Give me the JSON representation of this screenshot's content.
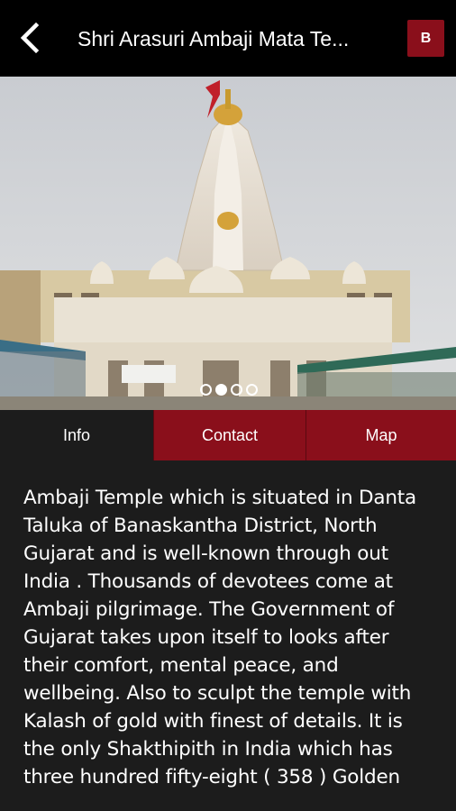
{
  "appbar": {
    "title": "Shri Arasuri Ambaji Mata Te...",
    "badge_label": "B",
    "back_icon": "chevron-left-icon"
  },
  "carousel": {
    "image_alt": "Ambaji temple photo",
    "current_index": 2,
    "count": 4
  },
  "tabs": [
    {
      "label": "Info",
      "active": true
    },
    {
      "label": "Contact",
      "active": false
    },
    {
      "label": "Map",
      "active": false
    }
  ],
  "info": {
    "body": "Ambaji Temple which is situated in Danta Taluka of Banaskantha District, North Gujarat and is well-known through out India . Thousands of devotees come at Ambaji pilgrimage. The Government of Gujarat takes upon itself to looks after their comfort, mental peace, and wellbeing. Also to sculpt the temple with Kalash of gold with finest of details. It is the only Shakthipith in India which has three hundred fifty-eight ( 358 ) Golden"
  },
  "colors": {
    "accent": "#8a0f1b",
    "appbar": "#000000",
    "background": "#1c1c1c"
  }
}
